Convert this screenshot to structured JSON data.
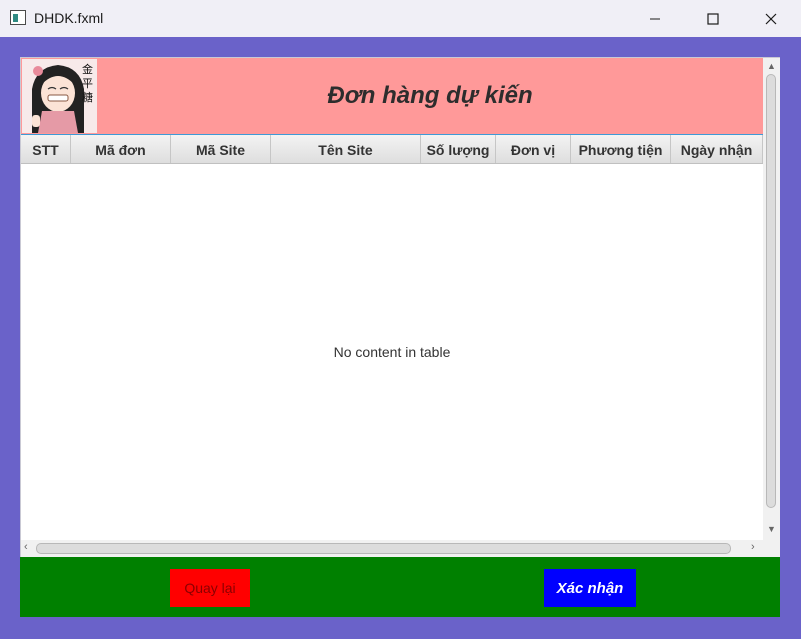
{
  "window": {
    "title": "DHDK.fxml",
    "icons": {
      "app": "window-icon",
      "minimize": "minimize-icon",
      "maximize": "maximize-icon",
      "close": "close-icon"
    }
  },
  "header": {
    "title": "Đơn hàng dự kiến",
    "avatar": "anime-girl-avatar",
    "background_color": "#ff9999"
  },
  "table": {
    "columns": [
      "STT",
      "Mã đơn",
      "Mã Site",
      "Tên Site",
      "Số lượng",
      "Đơn vị",
      "Phương tiện",
      "Ngày nhận"
    ],
    "rows": [],
    "empty_message": "No content in table"
  },
  "footer": {
    "back_label": "Quay lại",
    "confirm_label": "Xác nhận",
    "background_color": "#008000",
    "back_color": "#ff0000",
    "confirm_color": "#0000ff"
  }
}
